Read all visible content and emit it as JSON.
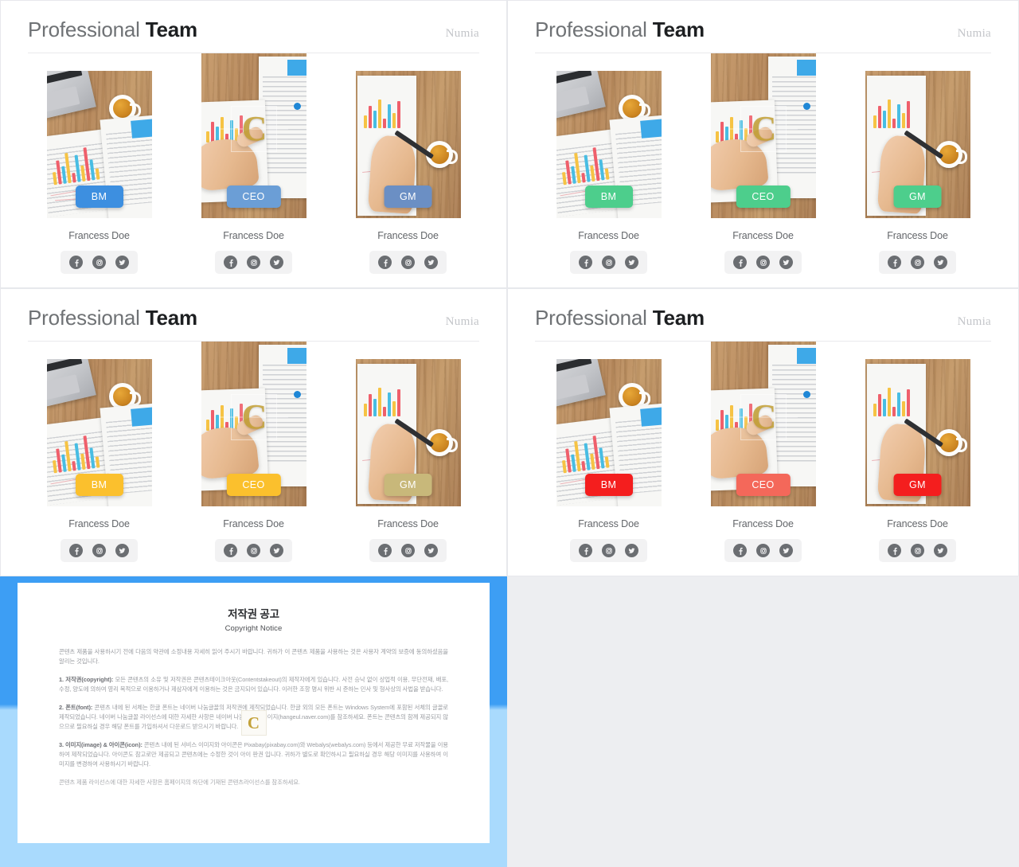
{
  "panels": [
    {
      "id": "panel-blue",
      "title_light": "Professional",
      "title_strong": "Team",
      "brand": "Numia",
      "accent": "#3d8fe0",
      "accent_featured": "#6b9ed6",
      "members": [
        {
          "role": "BM",
          "name": "Francess Doe",
          "variant": "desk"
        },
        {
          "role": "CEO",
          "name": "Francess Doe",
          "variant": "finger"
        },
        {
          "role": "GM",
          "name": "Francess Doe",
          "variant": "pen"
        }
      ]
    },
    {
      "id": "panel-green",
      "title_light": "Professional",
      "title_strong": "Team",
      "brand": "Numia",
      "accent": "#4dce8c",
      "accent_featured": "#4dce8c",
      "members": [
        {
          "role": "BM",
          "name": "Francess Doe",
          "variant": "desk"
        },
        {
          "role": "CEO",
          "name": "Francess Doe",
          "variant": "finger"
        },
        {
          "role": "GM",
          "name": "Francess Doe",
          "variant": "pen"
        }
      ]
    },
    {
      "id": "panel-yellow",
      "title_light": "Professional",
      "title_strong": "Team",
      "brand": "Numia",
      "accent": "#fbc02d",
      "accent_featured": "#fbc02d",
      "members": [
        {
          "role": "BM",
          "name": "Francess Doe",
          "variant": "desk"
        },
        {
          "role": "CEO",
          "name": "Francess Doe",
          "variant": "finger"
        },
        {
          "role": "GM",
          "name": "Francess Doe",
          "variant": "pen"
        }
      ]
    },
    {
      "id": "panel-red",
      "title_light": "Professional",
      "title_strong": "Team",
      "brand": "Numia",
      "accent": "#f41e1e",
      "accent_featured": "#f4685a",
      "members": [
        {
          "role": "BM",
          "name": "Francess Doe",
          "variant": "desk"
        },
        {
          "role": "CEO",
          "name": "Francess Doe",
          "variant": "finger"
        },
        {
          "role": "GM",
          "name": "Francess Doe",
          "variant": "pen"
        }
      ]
    }
  ],
  "social": {
    "facebook_label": "facebook",
    "instagram_label": "instagram",
    "twitter_label": "twitter"
  },
  "copyright": {
    "frame_color": "#3d9ef4",
    "title": "저작권 공고",
    "subtitle": "Copyright Notice",
    "watermark": "C",
    "intro": "콘텐츠 제품을 사용하시기 전에 다음의 약관에 소정내용 자세히 읽어 주시기 바랍니다. 귀하가 이 콘텐츠 제품을 사용하는 것은 사용자 계약의 보증에 동의하셨음을 알리는 것입니다.",
    "clause1_label": "1. 저작권(copyright):",
    "clause1_text": "모든 콘텐츠의 소유 및 저작권은 콘텐츠테이크아웃(Contentstakeout)의 제작자에게 있습니다. 사전 승낙 없이 상업적 이용, 무단전재, 배포, 수정, 양도에 의하여 영리 목적으로 이용하거나 제삼자에게 이용하는 것은 금지되어 있습니다. 이러한 조항 명시 위반 시 준하는 민사 및 형사상의 사법을 받습니다.",
    "clause2_label": "2. 폰트(font):",
    "clause2_text": "콘텐츠 내에 된 서체는 한글 폰트는 네이버 나눔글꼴의 저작권에 제작되었습니다. 한글 외의 모든 폰트는 Windows System에 포함된 서체의 글꼴로 제작되었습니다. 네이버 나눔글꼴 라이선스에 대한 자세한 사항은 네이버 나눔글꼴 홈페이지(hangeul.naver.com)를 참조하세요. 폰트는 콘텐츠의 함께 제공되지 않으므로 필요하실 경우 해당 폰트를 가입하셔서 다운로드 받으시기 바랍니다.",
    "clause3_label": "3. 이미지(image) & 아이콘(icon):",
    "clause3_text": "콘텐츠 내에 된 서비스 이미지와 아이콘은 Pixabay(pixabay.com)와 Webalys(webalys.com) 등에서 제공한 무료 저작물을 이용하여 제작되었습니다. 아이콘도 참고로만 제공되고 콘텐츠에는 수정한 것이 아이 판권 입니다. 귀하가 별도로 확인하시고 필요하실 경우 해당 이미지를 사용하여 이미지를 변경하여 사용하시기 바랍니다.",
    "footer": "콘텐츠 제품 라이선스에 대한 자세한 사항은 홈페이지의 하단에 기재된 콘텐츠라이선스를 참조하세요."
  }
}
